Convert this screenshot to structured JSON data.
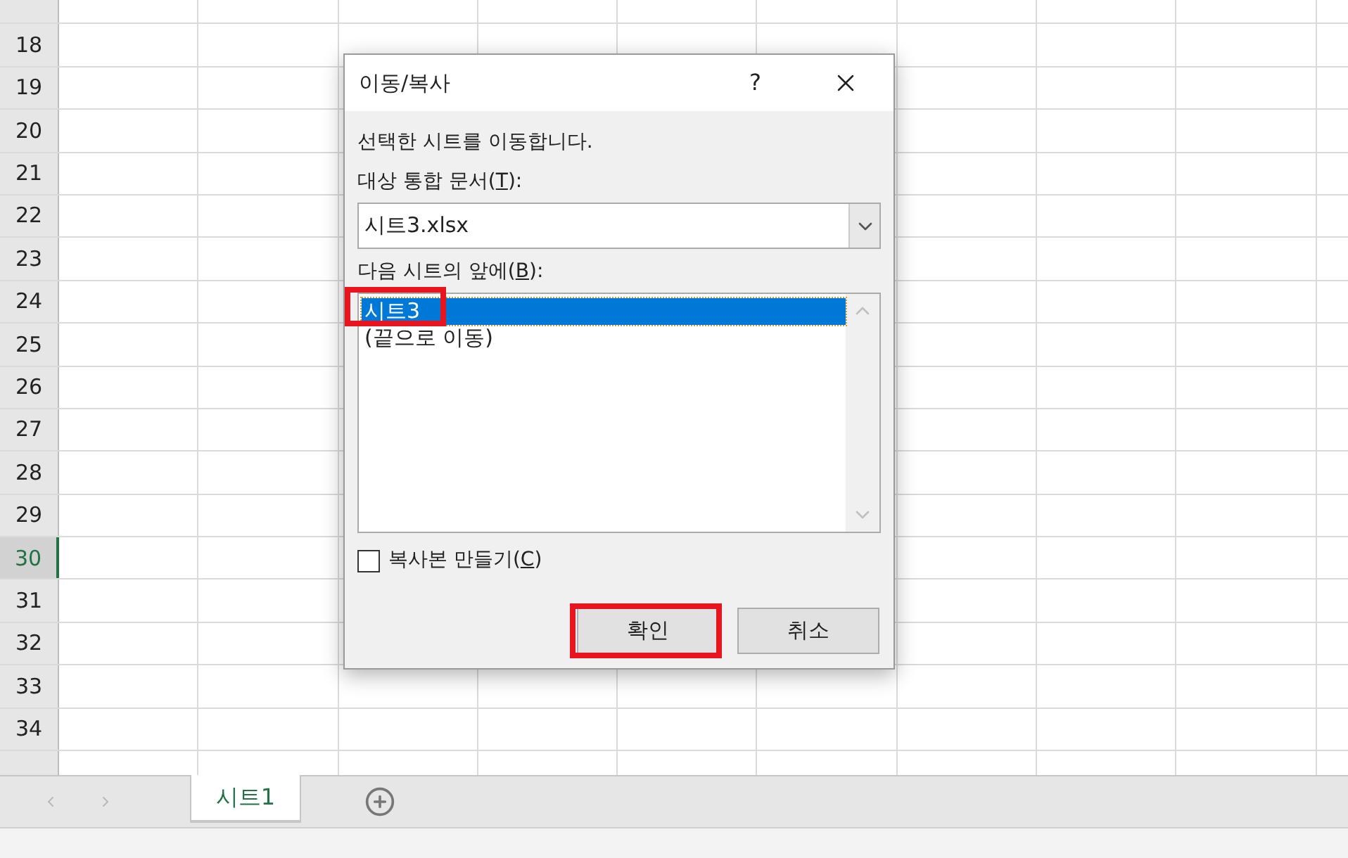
{
  "sheet": {
    "rows": [
      {
        "label": "18",
        "selected": false
      },
      {
        "label": "19",
        "selected": false
      },
      {
        "label": "20",
        "selected": false
      },
      {
        "label": "21",
        "selected": false
      },
      {
        "label": "22",
        "selected": false
      },
      {
        "label": "23",
        "selected": false
      },
      {
        "label": "24",
        "selected": false
      },
      {
        "label": "25",
        "selected": false
      },
      {
        "label": "26",
        "selected": false
      },
      {
        "label": "27",
        "selected": false
      },
      {
        "label": "28",
        "selected": false
      },
      {
        "label": "29",
        "selected": false
      },
      {
        "label": "30",
        "selected": true
      },
      {
        "label": "31",
        "selected": false
      },
      {
        "label": "32",
        "selected": false
      },
      {
        "label": "33",
        "selected": false
      },
      {
        "label": "34",
        "selected": false
      }
    ]
  },
  "sheet_tabs": [
    {
      "label": "시트1",
      "selected": true
    }
  ],
  "dialog": {
    "title": "이동/복사",
    "help": "?",
    "message": "선택한 시트를 이동합니다.",
    "workbook_label": {
      "before": "대상 통합 문서(",
      "key": "T",
      "after": "):"
    },
    "workbook_value": "시트3.xlsx",
    "sheet_label": {
      "before": "다음 시트의 앞에(",
      "key": "B",
      "after": "):"
    },
    "sheet_list": [
      {
        "label": "시트3",
        "selected": true,
        "highlighted": true
      },
      {
        "label": "(끝으로 이동)",
        "selected": false,
        "highlighted": false
      }
    ],
    "copy_checkbox": {
      "before": "복사본 만들기(",
      "key": "C",
      "after": ")",
      "checked": false
    },
    "buttons": [
      {
        "label": "확인",
        "highlighted": true
      },
      {
        "label": "취소",
        "highlighted": false
      }
    ]
  }
}
